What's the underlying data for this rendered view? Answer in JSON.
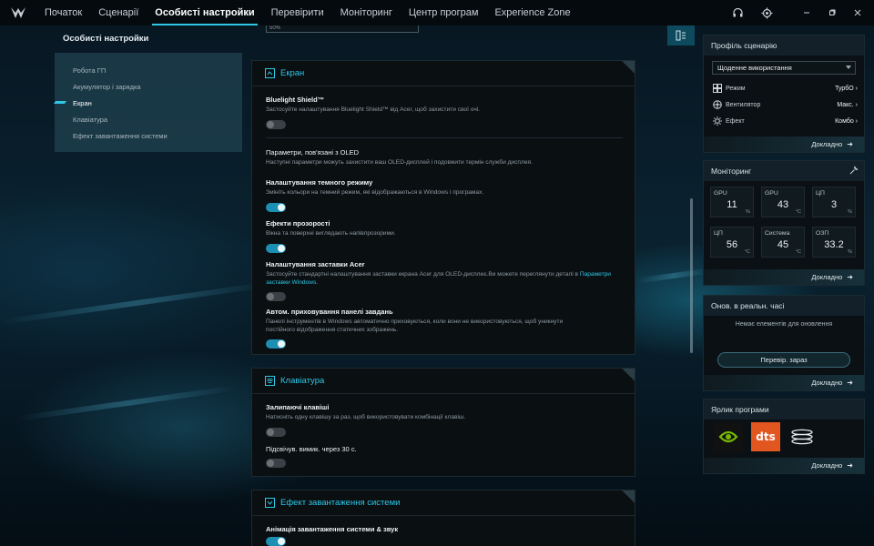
{
  "nav": {
    "items": [
      "Початок",
      "Сценарії",
      "Особисті настройки",
      "Перевірити",
      "Моніторинг",
      "Центр програм",
      "Experience Zone"
    ],
    "active_index": 2
  },
  "sidebar": {
    "title": "Особисті настройки",
    "items": [
      {
        "label": "Робота ГП",
        "active": false
      },
      {
        "label": "Акумулятор і зарядка",
        "active": false
      },
      {
        "label": "Екран",
        "active": true
      },
      {
        "label": "Клавіатура",
        "active": false
      },
      {
        "label": "Ефект завантаження системи",
        "active": false
      }
    ]
  },
  "center": {
    "dropdown_remnant": "50%",
    "screen": {
      "header": "Екран",
      "bluelight": {
        "title": "Bluelight Shield™",
        "desc": "Застосуйте налаштування Bluelight Shield™ від Acer, щоб захистити свої очі.",
        "on": false
      },
      "oled": {
        "title": "Параметри, пов'язані з OLED",
        "desc": "Наступні параметри можуть захистити ваш OLED-дисплей і подовжити термін служби дисплея."
      },
      "dark_mode": {
        "title": "Налаштування темного режиму",
        "desc": "Змініть кольори на темний режим, які відображаються в Windows і програмах.",
        "on": true
      },
      "transparency": {
        "title": "Ефекти прозорості",
        "desc": "Вікна та поверхні виглядають напівпрозорими.",
        "on": true
      },
      "screensaver": {
        "title": "Налаштування заставки Acer",
        "desc": "Застосуйте стандартні налаштування заставки екрана Acer для OLED-дисплеє.Ви можете переглянути деталі в",
        "link": "Параметри заставки Windows",
        "tail": ".",
        "on": false
      },
      "taskbar": {
        "title": "Автом. приховування панелі завдань",
        "desc1": "Панелі інструментів в Windows автоматично приховуються, коли вони не використовуються, щоб уникнути",
        "desc2": "постійного відображення статичних зображень.",
        "on": true
      }
    },
    "keyboard": {
      "header": "Клавіатура",
      "sticky": {
        "title": "Залипаючі клавіші",
        "desc": "Натисніть одну клавішу за раз, щоб використовувати комбінації клавіш.",
        "on": false
      },
      "backlight": {
        "title": "Підсвічув. вимик. через 30 с.",
        "on": false
      }
    },
    "boot": {
      "header": "Ефект завантаження системи",
      "anim": {
        "title": "Анімація завантаження системи & звук",
        "on": true
      }
    }
  },
  "right": {
    "profile": {
      "title": "Профіль сценарію",
      "selected": "Щоденне використання",
      "rows": [
        {
          "label": "Режим",
          "value": "ТурбО",
          "icon": "grid-icon"
        },
        {
          "label": "Вентилятор",
          "value": "Макс.",
          "icon": "fan-icon"
        },
        {
          "label": "Ефект",
          "value": "Комбо",
          "icon": "sun-icon"
        }
      ],
      "more": "Докладно"
    },
    "monitoring": {
      "title": "Моніторинг",
      "tiles": [
        {
          "label": "GPU",
          "value": "11",
          "unit": "%"
        },
        {
          "label": "GPU",
          "value": "43",
          "unit": "°C"
        },
        {
          "label": "ЦП",
          "value": "3",
          "unit": "%"
        },
        {
          "label": "ЦП",
          "value": "56",
          "unit": "°C"
        },
        {
          "label": "Система",
          "value": "45",
          "unit": "°C"
        },
        {
          "label": "ОЗП",
          "value": "33.2",
          "unit": "%"
        }
      ],
      "more": "Докладно"
    },
    "realtime": {
      "title": "Онов. в реальн. часі",
      "message": "Немає елементів для оновлення",
      "button": "Перевір. зараз",
      "more": "Докладно"
    },
    "shortcuts": {
      "title": "Ярлик програми",
      "apps": [
        "nvidia-icon",
        "dts-icon",
        "app-rings-icon"
      ],
      "dts_text": "dts",
      "more": "Докладно"
    }
  },
  "colors": {
    "accent": "#2ec7e6",
    "toggle_on": "#1d8fb3",
    "dts_orange": "#e2561f",
    "nvidia_green": "#76b900"
  }
}
